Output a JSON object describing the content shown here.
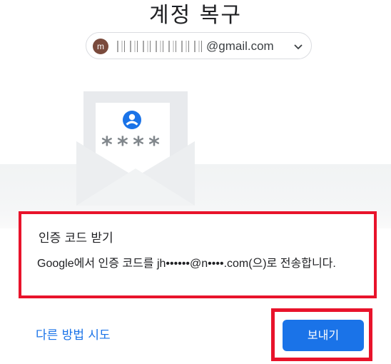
{
  "page": {
    "title": "계정 복구"
  },
  "account": {
    "avatar_letter": "m",
    "email_domain": "@gmail.com"
  },
  "illustration": {
    "masked_code": "****"
  },
  "option_card": {
    "heading": "인증 코드 받기",
    "description": "Google에서 인증 코드를 jh••••••@n••••.com(으)로 전송합니다."
  },
  "actions": {
    "alternate_label": "다른 방법 시도",
    "send_label": "보내기"
  },
  "colors": {
    "accent": "#1a73e8",
    "highlight": "#e8132b"
  }
}
